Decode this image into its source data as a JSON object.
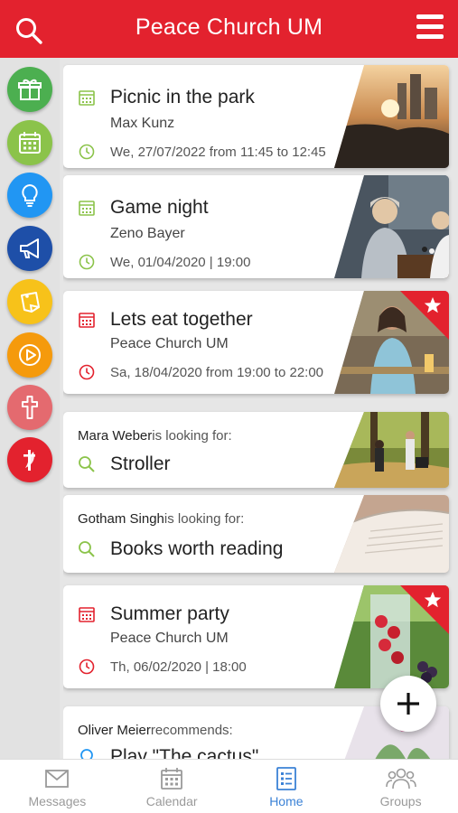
{
  "header": {
    "title": "Peace Church UM",
    "search_icon": "search-icon",
    "menu_icon": "hamburger-menu-icon"
  },
  "sidebar": {
    "items": [
      {
        "name": "gift",
        "icon": "gift-icon",
        "color": "#4caf50"
      },
      {
        "name": "calendar",
        "icon": "calendar-icon",
        "color": "#8bc34a"
      },
      {
        "name": "ideas",
        "icon": "lightbulb-icon",
        "color": "#2196f3"
      },
      {
        "name": "announcements",
        "icon": "megaphone-icon",
        "color": "#1e4fa8"
      },
      {
        "name": "notes",
        "icon": "sticky-note-icon",
        "color": "#f7c21a"
      },
      {
        "name": "media",
        "icon": "play-icon",
        "color": "#f59a0c"
      },
      {
        "name": "faith",
        "icon": "cross-icon",
        "color": "#e46a6f"
      },
      {
        "name": "church",
        "icon": "methodist-cross-icon",
        "color": "#e3222e"
      }
    ]
  },
  "feed": {
    "events": [
      {
        "title": "Picnic in the park",
        "organizer": "Max Kunz",
        "date": "We, 27/07/2022 from 11:45 to 12:45",
        "icon_color": "#8bc34a",
        "starred": false
      },
      {
        "title": "Game night",
        "organizer": "Zeno Bayer",
        "date": "We, 01/04/2020 | 19:00",
        "icon_color": "#8bc34a",
        "starred": false
      },
      {
        "title": "Lets eat together",
        "organizer": "Peace Church UM",
        "date": "Sa, 18/04/2020 from 19:00 to 22:00",
        "icon_color": "#e3222e",
        "starred": true
      }
    ],
    "requests": [
      {
        "person": "Mara Weber",
        "verb": " is looking for:",
        "item": "Stroller"
      },
      {
        "person": "Gotham Singh",
        "verb": " is looking for:",
        "item": "Books worth reading"
      }
    ],
    "party": {
      "title": "Summer party",
      "organizer": "Peace Church UM",
      "date": "Th, 06/02/2020 | 18:00",
      "icon_color": "#e3222e",
      "starred": true
    },
    "recommendation": {
      "person": "Oliver Meier",
      "verb": " recommends:",
      "item": "Play \"The cactus\""
    }
  },
  "fab": {
    "icon": "plus-icon"
  },
  "tabbar": {
    "tabs": [
      {
        "label": "Messages",
        "icon": "envelope-icon",
        "active": false
      },
      {
        "label": "Calendar",
        "icon": "calendar-icon",
        "active": false
      },
      {
        "label": "Home",
        "icon": "list-icon",
        "active": true
      },
      {
        "label": "Groups",
        "icon": "people-icon",
        "active": false
      }
    ]
  },
  "colors": {
    "brand_red": "#e3222e",
    "active_blue": "#3b82d6",
    "event_green": "#8bc34a"
  }
}
